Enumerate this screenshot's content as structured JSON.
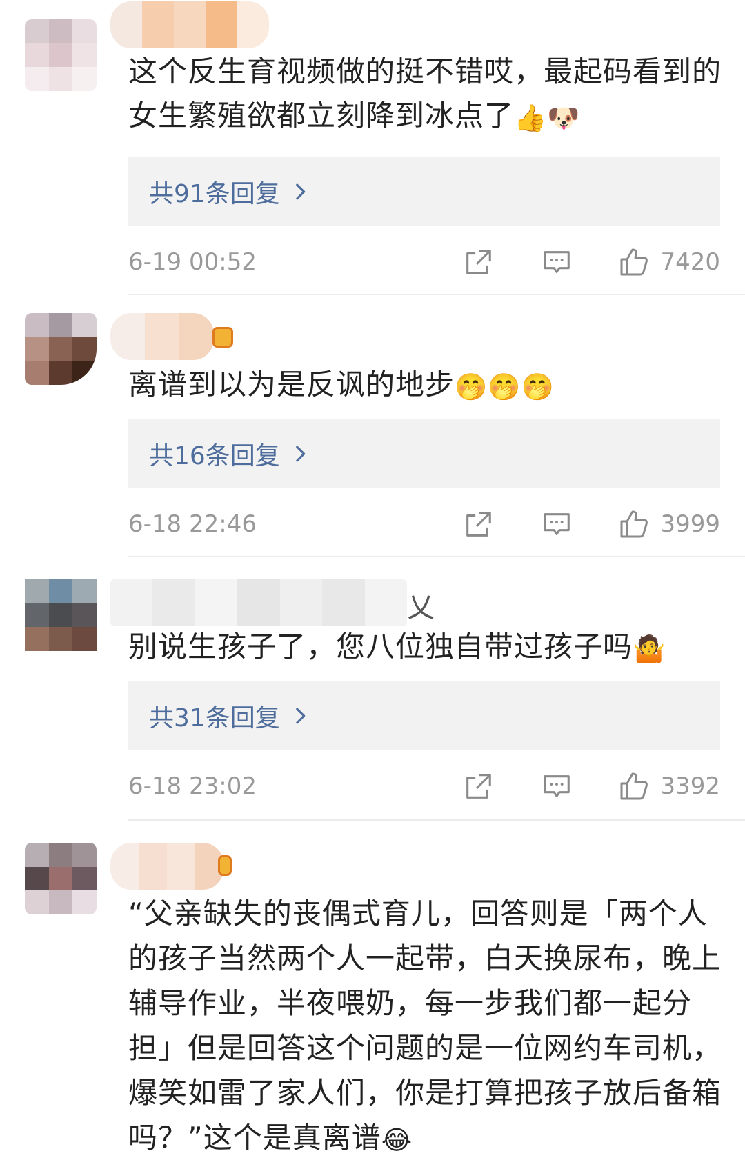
{
  "comments": [
    {
      "text": "这个反生育视频做的挺不错哎，最起码看到的女生繁殖欲都立刻降到冰点了",
      "emojis": [
        "👍",
        "🐶"
      ],
      "reply_label": "共91条回复",
      "time": "6-19 00:52",
      "likes": "7420"
    },
    {
      "text": "离谱到以为是反讽的地步",
      "emojis": [
        "🤭",
        "🤭",
        "🤭"
      ],
      "reply_label": "共16条回复",
      "time": "6-18 22:46",
      "likes": "3999"
    },
    {
      "text": "别说生孩子了，您八位独自带过孩子吗",
      "emojis": [
        "🤷"
      ],
      "reply_label": "共31条回复",
      "time": "6-18 23:02",
      "likes": "3392"
    },
    {
      "text": "“父亲缺失的丧偶式育儿，回答则是「两个人的孩子当然两个人一起带，白天换尿布，晚上辅导作业，半夜喂奶，每一步我们都一起分担」但是回答这个问题的是一位网约车司机，爆笑如雷了家人们，你是打算把孩子放后备箱吗？”这个是真离谱",
      "emojis": [
        "😂"
      ]
    }
  ],
  "icons": {
    "share": "share-icon",
    "comment": "comment-icon",
    "like": "thumbs-up-icon",
    "chevron": "chevron-right-icon"
  },
  "colors": {
    "reply_link": "#4e6d9c",
    "meta_gray": "#999999",
    "reply_bg": "#f2f2f2"
  }
}
